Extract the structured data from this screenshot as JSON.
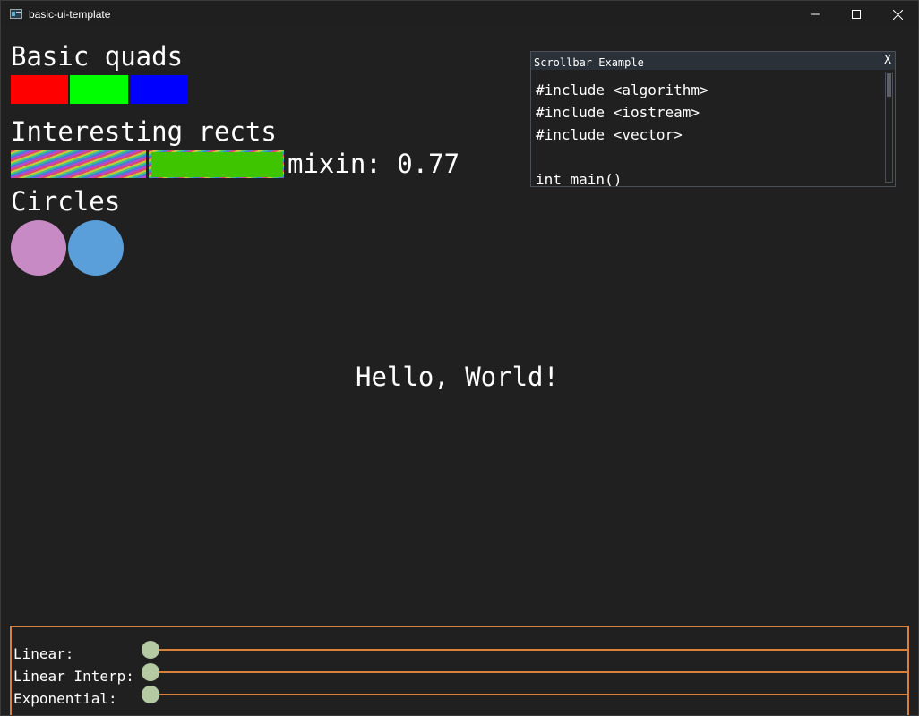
{
  "window": {
    "title": "basic-ui-template",
    "min_glyph": "—",
    "max_glyph": "☐",
    "close_glyph": "✕"
  },
  "sections": {
    "quads_heading": "Basic quads",
    "rects_heading": "Interesting rects",
    "circles_heading": "Circles"
  },
  "quads": [
    {
      "color": "#ff0000"
    },
    {
      "color": "#00ff00"
    },
    {
      "color": "#0000ff"
    }
  ],
  "rects": {
    "mixin_label": "mixin: 0.77",
    "mixin_value": 0.77,
    "mixin_color": "#3fc400"
  },
  "circles": [
    {
      "color": "#c78ac4"
    },
    {
      "color": "#5a9fd9"
    }
  ],
  "hello": "Hello, World!",
  "scroll_panel": {
    "title": "Scrollbar Example",
    "close_label": "X",
    "code_lines": [
      "#include <algorithm>",
      "#include <iostream>",
      "#include <vector>",
      "",
      "int main()"
    ]
  },
  "sliders": [
    {
      "label": "Linear:",
      "value": 0.0
    },
    {
      "label": "Linear Interp:",
      "value": 0.0
    },
    {
      "label": "Exponential:",
      "value": 0.0
    }
  ],
  "colors": {
    "accent": "#d9803a",
    "slider_handle": "#b5c9a3",
    "background": "#202020"
  }
}
